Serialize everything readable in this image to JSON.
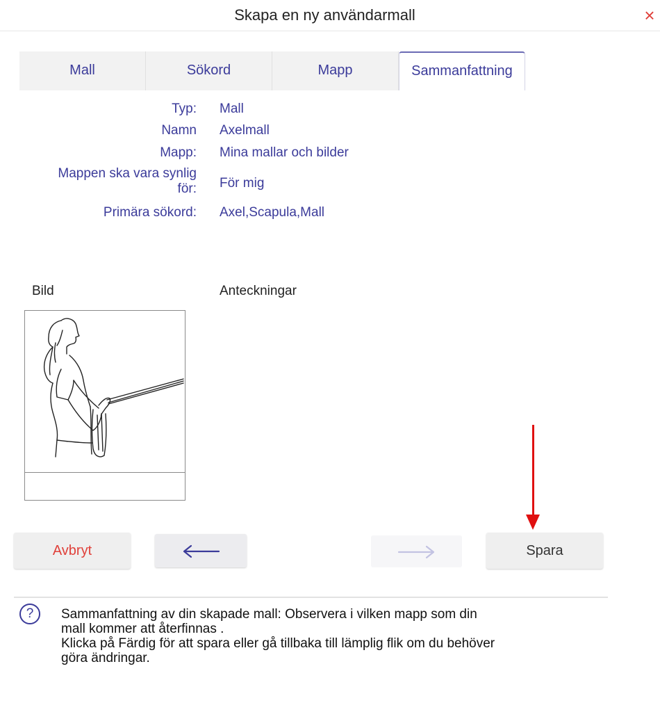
{
  "dialog": {
    "title": "Skapa en ny användarmall",
    "close_glyph": "×"
  },
  "tabs": [
    {
      "label": "Mall",
      "active": false
    },
    {
      "label": "Sökord",
      "active": false
    },
    {
      "label": "Mapp",
      "active": false
    },
    {
      "label": "Sammanfattning",
      "active": true
    }
  ],
  "summary": [
    {
      "label": "Typ:",
      "value": "Mall"
    },
    {
      "label": "Namn",
      "value": "Axelmall"
    },
    {
      "label": "Mapp:",
      "value": "Mina mallar och bilder"
    },
    {
      "label_line1": "Mappen ska vara synlig",
      "label_line2": "för:",
      "value": "För mig"
    },
    {
      "label": "Primära sökord:",
      "value": "Axel,Scapula,Mall"
    }
  ],
  "image_section": {
    "label": "Bild",
    "picture_icon": "exercise-illustration"
  },
  "notes_section": {
    "label": "Anteckningar"
  },
  "buttons": {
    "cancel": "Avbryt",
    "back_glyph": "←",
    "next_glyph": "→",
    "save": "Spara"
  },
  "help": {
    "icon_glyph": "?",
    "line1": "Sammanfattning av din skapade mall: Observera i vilken mapp som din",
    "line2": "mall kommer att återfinnas .",
    "line3": "Klicka på Färdig för att spara eller gå tillbaka till lämplig flik om du behöver",
    "line4": "göra ändringar."
  },
  "colors": {
    "accent": "#3b3b9a",
    "danger": "#e0403a",
    "annotation_arrow": "#e01010"
  }
}
